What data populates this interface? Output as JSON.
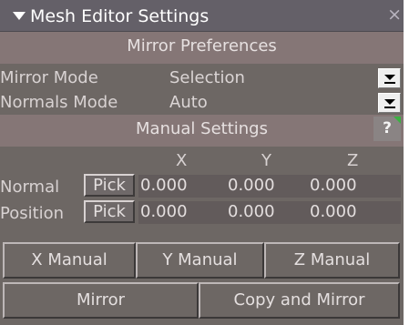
{
  "titlebar": {
    "title": "Mesh Editor Settings",
    "collapse_icon": "triangle-down-icon",
    "close_glyph": "×"
  },
  "mirror_preferences": {
    "header": "Mirror Preferences",
    "mirror_mode": {
      "label": "Mirror Mode",
      "value": "Selection"
    },
    "normals_mode": {
      "label": "Normals Mode",
      "value": "Auto"
    }
  },
  "manual_settings": {
    "header": "Manual Settings",
    "help_glyph": "?",
    "columns": [
      "X",
      "Y",
      "Z"
    ],
    "rows": [
      {
        "label": "Normal",
        "pick": "Pick",
        "x": "0.000",
        "y": "0.000",
        "z": "0.000"
      },
      {
        "label": "Position",
        "pick": "Pick",
        "x": "0.000",
        "y": "0.000",
        "z": "0.000"
      }
    ]
  },
  "buttons": {
    "x_manual": "X Manual",
    "y_manual": "Y Manual",
    "z_manual": "Z Manual",
    "mirror": "Mirror",
    "copy_and_mirror": "Copy and Mirror"
  },
  "colors": {
    "panel_bg": "#6d6764",
    "section_bg": "#857676",
    "titlebar_bg": "#646068",
    "help_corner": "#3cb043"
  }
}
